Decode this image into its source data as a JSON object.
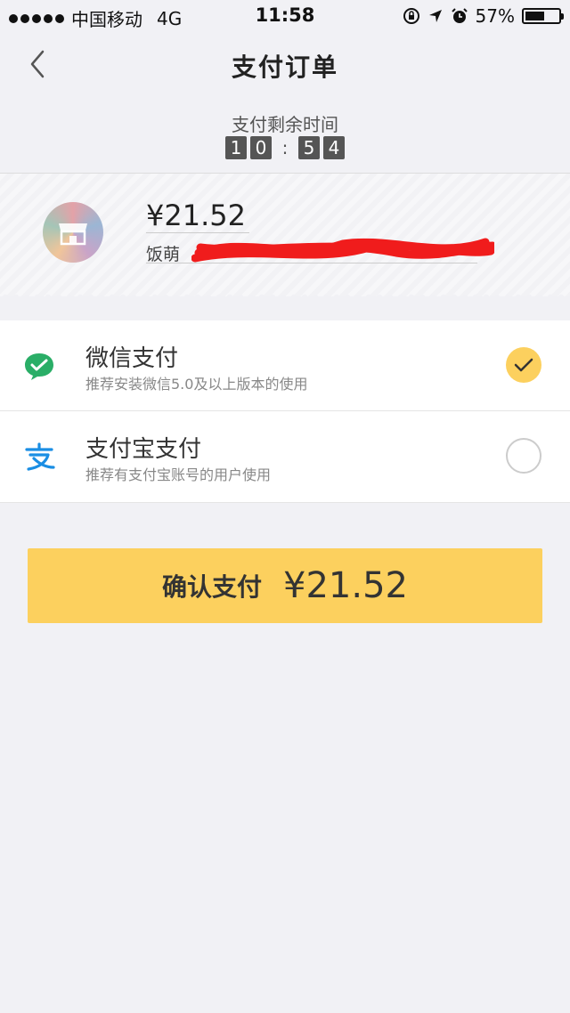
{
  "status_bar": {
    "carrier": "中国移动",
    "network": "4G",
    "time": "11:58",
    "battery": "57%",
    "battery_level": 0.57
  },
  "nav": {
    "title": "支付订单"
  },
  "timer": {
    "label": "支付剩余时间",
    "digits": [
      "1",
      "0",
      "5",
      "4"
    ],
    "separator": ":"
  },
  "order": {
    "amount": "¥21.52",
    "shop_name": "饭萌"
  },
  "payments": [
    {
      "title": "微信支付",
      "subtitle": "推荐安装微信5.0及以上版本的使用",
      "selected": true,
      "icon": "wechat-pay-icon",
      "color": "#2aae67"
    },
    {
      "title": "支付宝支付",
      "subtitle": "推荐有支付宝账号的用户使用",
      "selected": false,
      "icon": "alipay-icon",
      "color": "#1a8ee4"
    }
  ],
  "confirm": {
    "label": "确认支付",
    "amount": "¥21.52"
  },
  "colors": {
    "accent": "#fcd05e",
    "background": "#f1f1f5"
  }
}
